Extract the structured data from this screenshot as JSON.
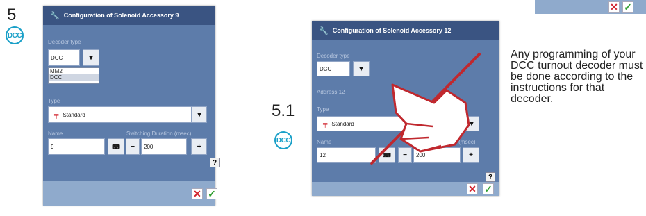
{
  "step5": {
    "number": "5",
    "badge": "DCC"
  },
  "step51": {
    "number": "5.1",
    "badge": "DCC"
  },
  "dialog1": {
    "title": "Configuration of Solenoid Accessory 9",
    "decoder_type_label": "Decoder type",
    "decoder_type_value": "DCC",
    "decoder_options": [
      "MM2",
      "DCC"
    ],
    "type_label": "Type",
    "type_value": "Standard",
    "name_label": "Name",
    "duration_label": "Switching Duration (msec)",
    "name_value": "9",
    "duration_value": "200",
    "minus": "−",
    "plus": "+",
    "help": "?",
    "cancel": "✕",
    "ok": "✓"
  },
  "dialog2": {
    "title": "Configuration of Solenoid Accessory 12",
    "decoder_type_label": "Decoder type",
    "decoder_type_value": "DCC",
    "address_label": "Address 12",
    "type_label": "Type",
    "type_value": "Standard",
    "name_label": "Name",
    "duration_label_partial": "on (msec)",
    "name_value": "12",
    "duration_value": "200",
    "minus": "−",
    "plus": "+",
    "help": "?",
    "cancel": "✕",
    "ok": "✓"
  },
  "corner_panel": {
    "cancel": "✕",
    "ok": "✓"
  },
  "description": "Any programming of your DCC turnout decoder must be done according to the instructions for that decoder.",
  "colors": {
    "dialog_body": "#5d7caa",
    "dialog_header": "#3a5482",
    "dialog_footer": "#8faacc",
    "badge": "#1aa0c8",
    "cancel": "#d0202a",
    "ok": "#2f9e2f",
    "pen_hand_outline": "#c0282e"
  }
}
